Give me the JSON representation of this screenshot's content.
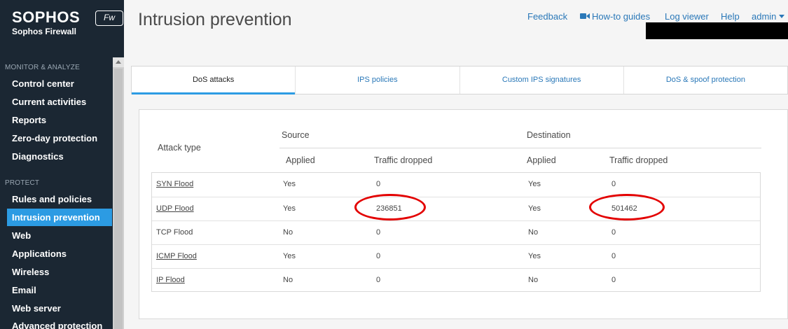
{
  "sidebar": {
    "brand": "SOPHOS",
    "badge": "Fw",
    "subtitle": "Sophos Firewall",
    "sections": [
      {
        "title": "MONITOR & ANALYZE",
        "items": [
          "Control center",
          "Current activities",
          "Reports",
          "Zero-day protection",
          "Diagnostics"
        ]
      },
      {
        "title": "PROTECT",
        "items": [
          "Rules and policies",
          "Intrusion prevention",
          "Web",
          "Applications",
          "Wireless",
          "Email",
          "Web server",
          "Advanced protection"
        ]
      }
    ],
    "active_item": "Intrusion prevention"
  },
  "header": {
    "title": "Intrusion prevention",
    "links": {
      "feedback": "Feedback",
      "howto": "How-to guides",
      "logviewer": "Log viewer",
      "help": "Help",
      "admin": "admin"
    }
  },
  "tabs": [
    "DoS attacks",
    "IPS policies",
    "Custom IPS signatures",
    "DoS & spoof protection"
  ],
  "active_tab": "DoS attacks",
  "table": {
    "col_attack": "Attack type",
    "group_source": "Source",
    "group_destination": "Destination",
    "col_applied": "Applied",
    "col_dropped": "Traffic dropped",
    "rows": [
      {
        "attack": "SYN Flood",
        "link": true,
        "src_applied": "Yes",
        "src_dropped": "0",
        "dst_applied": "Yes",
        "dst_dropped": "0"
      },
      {
        "attack": "UDP Flood",
        "link": true,
        "src_applied": "Yes",
        "src_dropped": "236851",
        "dst_applied": "Yes",
        "dst_dropped": "501462"
      },
      {
        "attack": "TCP Flood",
        "link": false,
        "src_applied": "No",
        "src_dropped": "0",
        "dst_applied": "No",
        "dst_dropped": "0"
      },
      {
        "attack": "ICMP Flood",
        "link": true,
        "src_applied": "Yes",
        "src_dropped": "0",
        "dst_applied": "Yes",
        "dst_dropped": "0"
      },
      {
        "attack": "IP Flood",
        "link": true,
        "src_applied": "No",
        "src_dropped": "0",
        "dst_applied": "No",
        "dst_dropped": "0"
      }
    ]
  },
  "colors": {
    "sidebar_bg": "#1b2733",
    "accent": "#2c9be3",
    "link": "#2a78b8",
    "highlight": "#e30000"
  }
}
